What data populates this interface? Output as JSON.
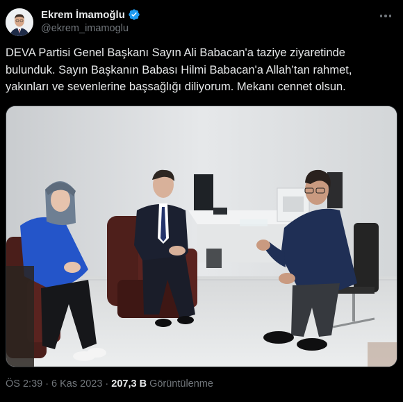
{
  "author": {
    "display_name": "Ekrem İmamoğlu",
    "handle": "@ekrem_imamoglu",
    "verified_icon": "verified-badge-icon"
  },
  "more_icon": "more-options-icon",
  "tweet": {
    "text": "DEVA Partisi Genel Başkanı Sayın Ali Babacan'a taziye ziyaretinde\nbulunduk. Sayın Başkanın Babası Hilmi Babacan'a Allah’tan rahmet,\nyakınları ve sevenlerine başsağlığı diliyorum. Mekanı cennet olsun."
  },
  "media": {
    "kind": "photo"
  },
  "footer": {
    "time": "ÖS 2:39",
    "separator": "·",
    "date": "6 Kas 2023",
    "views_count": "207,3 B",
    "views_label": "Görüntülenme"
  },
  "colors": {
    "background": "#000000",
    "text": "#e7e9ea",
    "muted": "#71767b",
    "verified": "#1d9bf0",
    "border": "#2f3336"
  }
}
